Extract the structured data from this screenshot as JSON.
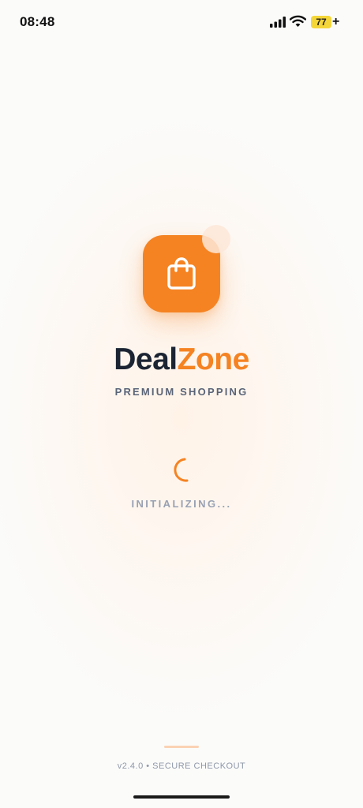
{
  "status_bar": {
    "time": "08:48",
    "battery_level": "77",
    "charging_symbol": "+",
    "icons": [
      "signal-icon",
      "wifi-icon",
      "battery-icon"
    ]
  },
  "splash": {
    "logo_icon": "shopping-bag-icon",
    "brand_part1": "Deal",
    "brand_part2": "Zone",
    "tagline": "PREMIUM SHOPPING",
    "loading_text": "INITIALIZING...",
    "footer": "v2.4.0 • SECURE CHECKOUT"
  },
  "colors": {
    "accent": "#f58322",
    "brand_dark": "#1b2433",
    "battery": "#f4d639",
    "background": "#fbfbfa"
  }
}
